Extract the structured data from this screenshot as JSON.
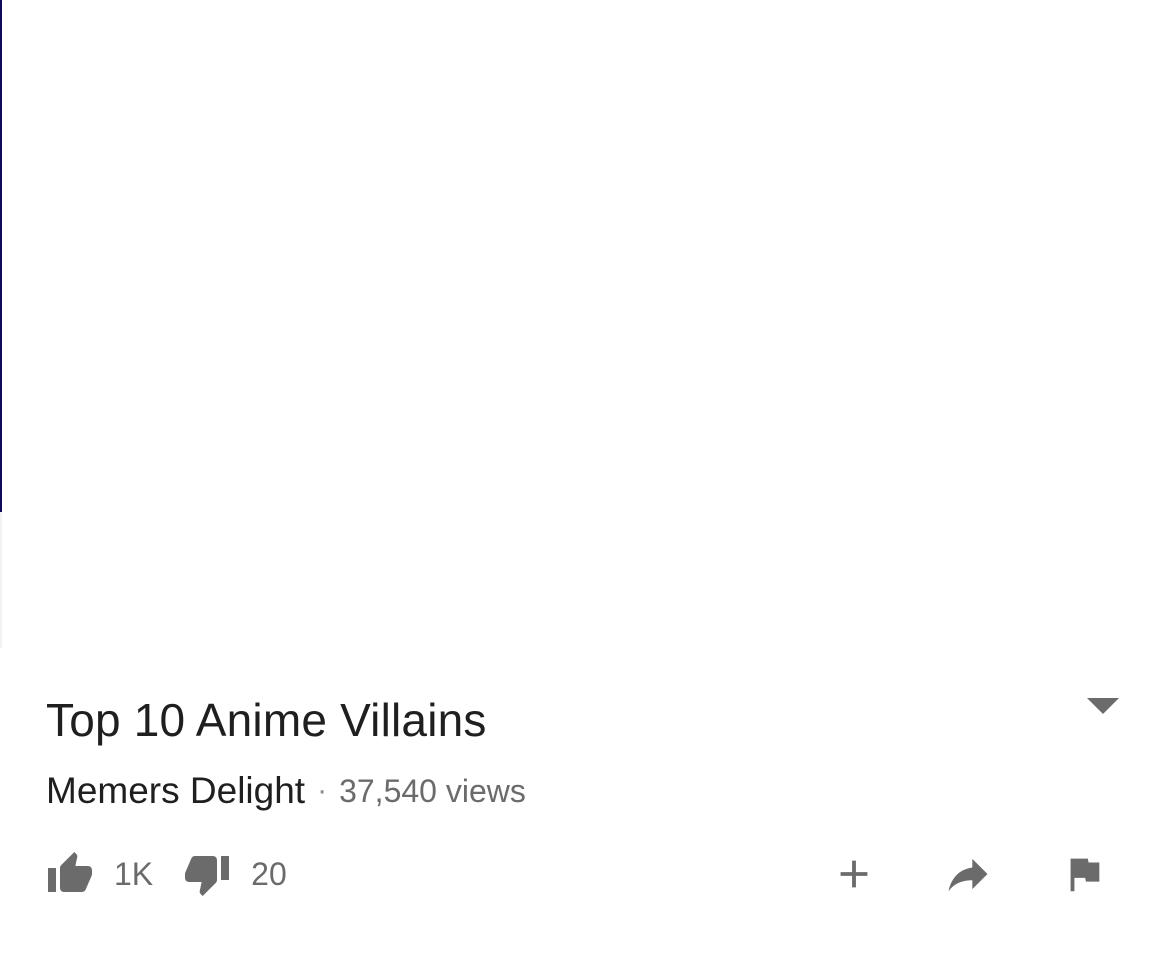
{
  "video": {
    "title": "Top 10 Anime Villains",
    "channel": "Memers Delight",
    "separator": "·",
    "views": "37,540 views"
  },
  "actions": {
    "like_count": "1K",
    "dislike_count": "20"
  },
  "icons": {
    "expand": "caret-down-icon",
    "like": "thumbs-up-icon",
    "dislike": "thumbs-down-icon",
    "add": "plus-icon",
    "share": "share-arrow-icon",
    "report": "flag-icon"
  },
  "colors": {
    "background": "#ffffff",
    "title_text": "#1f1f1f",
    "secondary_text": "#6b6b6b",
    "icon": "#6b6b6b"
  }
}
